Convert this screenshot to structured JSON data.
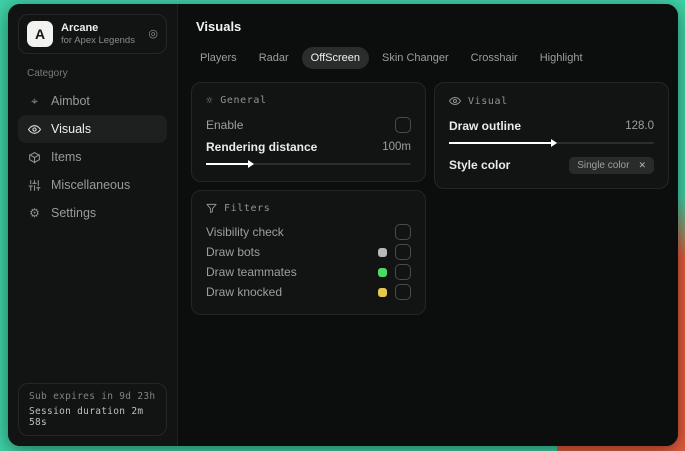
{
  "sidebar": {
    "logo_letter": "A",
    "app_name": "Arcane",
    "app_subtitle": "for Apex Legends",
    "category_label": "Category",
    "items": [
      {
        "label": "Aimbot"
      },
      {
        "label": "Visuals"
      },
      {
        "label": "Items"
      },
      {
        "label": "Miscellaneous"
      },
      {
        "label": "Settings"
      }
    ],
    "status_line1": "Sub expires in 9d 23h",
    "status_line2": "Session duration 2m 58s"
  },
  "header": {
    "title": "Visuals"
  },
  "tabs": [
    {
      "label": "Players"
    },
    {
      "label": "Radar"
    },
    {
      "label": "OffScreen"
    },
    {
      "label": "Skin Changer"
    },
    {
      "label": "Crosshair"
    },
    {
      "label": "Highlight"
    }
  ],
  "active_tab": "OffScreen",
  "panels": {
    "general": {
      "title": "General",
      "enable_label": "Enable",
      "enable_checked": false,
      "distance_label": "Rendering distance",
      "distance_value": "100m",
      "slider_fill": "21%"
    },
    "visual": {
      "title": "Visual",
      "outline_label": "Draw outline",
      "outline_value": "128.0",
      "slider_fill": "50%",
      "style_label": "Style color",
      "style_value": "Single color"
    },
    "filters": {
      "title": "Filters",
      "rows": [
        {
          "label": "Visibility check",
          "swatch": null,
          "checked": false
        },
        {
          "label": "Draw bots",
          "swatch": "#b8b8b8",
          "checked": false
        },
        {
          "label": "Draw teammates",
          "swatch": "#4cd964",
          "checked": false
        },
        {
          "label": "Draw knocked",
          "swatch": "#e6c94e",
          "checked": false
        }
      ]
    }
  },
  "colors": {
    "backdrop_teal": "#3ed0a6",
    "backdrop_orange": "#e25b3c",
    "swatch_gray": "#b8b8b8",
    "swatch_green": "#4cd964",
    "swatch_yellow": "#e6c94e"
  },
  "icons": {
    "aimbot_glyph": "⌖",
    "settings_glyph": "⚙",
    "general_glyph": "☼",
    "pin_glyph": "◎",
    "chip_close_glyph": "✕"
  }
}
